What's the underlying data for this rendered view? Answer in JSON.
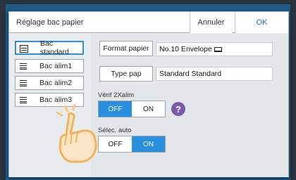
{
  "dialog": {
    "title": "Réglage bac papier",
    "cancel_label": "Annuler",
    "ok_label": "OK"
  },
  "trays": [
    {
      "label": "Bac standard",
      "selected": true
    },
    {
      "label": "Bac alim1",
      "selected": false
    },
    {
      "label": "Bac alim2",
      "selected": false
    },
    {
      "label": "Bac alim3",
      "selected": false
    }
  ],
  "settings": {
    "format_label": "Format papier",
    "format_value": "No.10 Envelope",
    "type_label": "Type pap",
    "type_value": "Standard Standard",
    "verif_label": "Vérif 2Xalim",
    "verif_off": "OFF",
    "verif_on": "ON",
    "verif_selected": "OFF",
    "help_glyph": "?",
    "auto_label": "Sélec. auto",
    "auto_off": "OFF",
    "auto_on": "ON",
    "auto_selected": "ON"
  },
  "icons": {
    "tray": "tray-icon",
    "envelope": "envelope-icon",
    "help": "help-icon",
    "hand": "pointing-hand-icon"
  },
  "colors": {
    "accent": "#2b8fe0",
    "selected_border": "#2f8fd6",
    "help": "#7a5aa8",
    "screen_background": "#1f5a86"
  }
}
